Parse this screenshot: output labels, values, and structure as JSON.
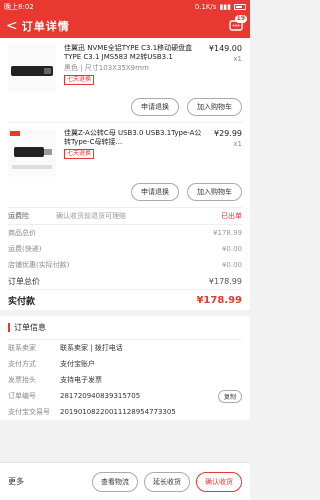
{
  "statusbar": {
    "time": "晚上8:02",
    "network": "0.1K/s",
    "battery": ""
  },
  "header": {
    "back": "<",
    "title": "订单详情",
    "badge": "19"
  },
  "items": [
    {
      "title": "佳翼迅 NVME全铝TYPE C3.1移动硬盘盒TYPE C3.1 JMS583 M2转USB3.1",
      "spec": "黑色 | 尺寸103X35X9mm",
      "tag": "七天退换",
      "price": "¥149.00",
      "qty": "x1",
      "actions": [
        "申请退换",
        "加入购物车"
      ]
    },
    {
      "title": "佳翼Z-A公转C母 USB3.0 USB3.1Type-A公转Type-C母转接...",
      "spec": "",
      "tag": "七天退换",
      "price": "¥29.99",
      "qty": "x1",
      "actions": [
        "申请退换",
        "加入购物车"
      ]
    }
  ],
  "shipping": {
    "label": "运费险",
    "value": "确认收货前退货可理赔",
    "right": "已出单"
  },
  "summary": [
    {
      "label": "商品总价",
      "value": "¥178.99"
    },
    {
      "label": "运费(快递)",
      "value": "¥0.00"
    },
    {
      "label": "店铺优惠(实际付款)",
      "value": "¥0.00"
    },
    {
      "label": "订单总价",
      "value": "¥178.99"
    }
  ],
  "paid": {
    "label": "实付款",
    "value": "¥178.99"
  },
  "order_info": {
    "heading": "订单信息",
    "rows": [
      {
        "k": "联系卖家",
        "v": "联系卖家 | 拨打电话"
      },
      {
        "k": "支付方式",
        "v": "支付宝账户"
      },
      {
        "k": "发票抬头",
        "v": "支持电子发票"
      },
      {
        "k": "订单编号",
        "v": "281720940839315705",
        "copy": "复制"
      },
      {
        "k": "支付宝交易号",
        "v": "20190108220011128954773305"
      }
    ]
  },
  "bottom": {
    "more": "更多",
    "btn1": "查看物流",
    "btn2": "延长收货",
    "btn3": "确认收货"
  }
}
